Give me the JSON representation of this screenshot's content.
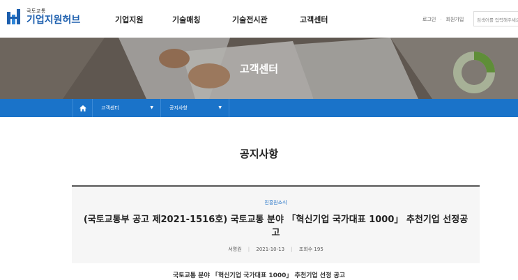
{
  "logo": {
    "small_text": "국토교통",
    "main_text": "기업지원허브"
  },
  "gnb": {
    "items": [
      "기업지원",
      "기술매칭",
      "기술전시관",
      "고객센터"
    ]
  },
  "util": {
    "login": "로그인",
    "separator": "·",
    "join": "회원가입"
  },
  "search": {
    "placeholder": "검색어를 입력해주세요"
  },
  "hero": {
    "title": "고객센터"
  },
  "breadcrumb": {
    "level1": "고객센터",
    "level2": "공지사항"
  },
  "page": {
    "title": "공지사항"
  },
  "article": {
    "category": "진흥원소식",
    "title": "(국토교통부 공고 제2021-1516호) 국토교통 분야 「혁신기업 국가대표 1000」 추천기업 선정공고",
    "author": "서명원",
    "date": "2021-10-13",
    "views": "조회수 195"
  },
  "content": {
    "first_line": "국토교통 분야 「혁신기업 국가대표 1000」 추천기업 선정 공고"
  },
  "colors": {
    "brand": "#1d5fae",
    "breadcrumb_bg": "#1a73c9",
    "category": "#1d6fc5"
  }
}
